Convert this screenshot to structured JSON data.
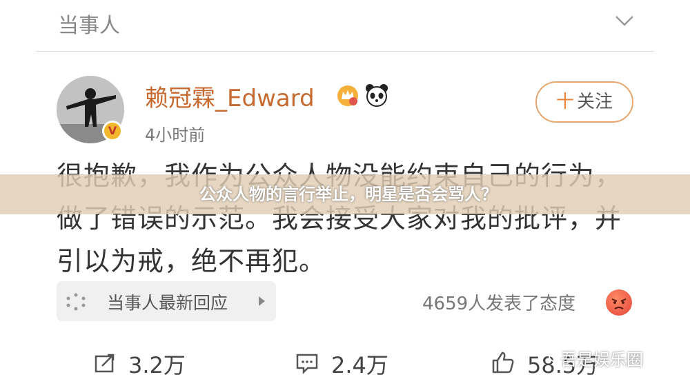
{
  "header": {
    "label": "当事人"
  },
  "post": {
    "username": "赖冠霖_Edward",
    "time": "4小时前",
    "follow_label": "关注",
    "follow_plus": "十",
    "text": "很抱歉，我作为公众人物没能约束自己的行为，做了错误的示范。我会接受大家对我的批评，并引以为戒，绝不再犯。",
    "verify_mark": "V"
  },
  "overlay": {
    "caption": "公众人物的言行举止，明星是否会骂人？"
  },
  "update": {
    "label": "当事人最新回应",
    "attitude": "4659人发表了态度"
  },
  "actions": {
    "repost": "3.2万",
    "comment": "2.4万",
    "like": "58.5万"
  },
  "watermark": {
    "text": "吾是娱乐圈"
  },
  "colors": {
    "username": "#c66a2f",
    "follow_border": "#e8a66f",
    "overlay": "#e1cdb4"
  },
  "icons": [
    "chevron-down-icon",
    "verify-badge-icon",
    "vip-crown-icon",
    "panda-icon",
    "spark-icon",
    "arrow-right-icon",
    "angry-face-icon",
    "repost-icon",
    "comment-icon",
    "like-icon",
    "wechat-icon"
  ]
}
